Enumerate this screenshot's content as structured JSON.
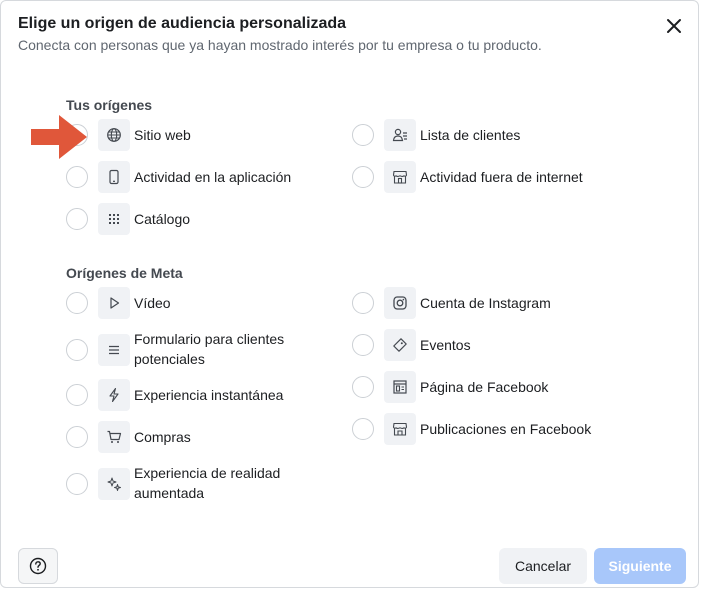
{
  "dialog": {
    "title": "Elige un origen de audiencia personalizada",
    "subtitle": "Conecta con personas que ya hayan mostrado interés por tu empresa o tu producto."
  },
  "sections": {
    "tus": {
      "heading": "Tus orígenes",
      "items": [
        {
          "label": "Sitio web",
          "icon": "globe-icon"
        },
        {
          "label": "Lista de clientes",
          "icon": "user-list-icon"
        },
        {
          "label": "Actividad en la aplicación",
          "icon": "mobile-icon"
        },
        {
          "label": "Actividad fuera de internet",
          "icon": "store-icon"
        },
        {
          "label": "Catálogo",
          "icon": "grid-icon"
        }
      ]
    },
    "meta": {
      "heading": "Orígenes de Meta",
      "items": [
        {
          "label": "Vídeo",
          "icon": "play-icon"
        },
        {
          "label": "Cuenta de Instagram",
          "icon": "instagram-icon"
        },
        {
          "label": "Formulario para clientes potenciales",
          "label_line1": "Formulario para clientes",
          "label_line2": "potenciales",
          "icon": "form-icon"
        },
        {
          "label": "Eventos",
          "icon": "ticket-icon"
        },
        {
          "label": "Experiencia instantánea",
          "icon": "lightning-icon"
        },
        {
          "label": "Página de Facebook",
          "icon": "facebook-page-icon"
        },
        {
          "label": "Compras",
          "icon": "cart-icon"
        },
        {
          "label": "Publicaciones en Facebook",
          "icon": "shop-icon"
        },
        {
          "label": "Experiencia de realidad aumentada",
          "label_line1": "Experiencia de realidad",
          "label_line2": "aumentada",
          "icon": "sparkle-icon"
        }
      ]
    }
  },
  "footer": {
    "cancel_label": "Cancelar",
    "next_label": "Siguiente"
  },
  "colors": {
    "annotation_arrow": "#e0573a",
    "next_button_disabled": "#a8c7fa"
  }
}
